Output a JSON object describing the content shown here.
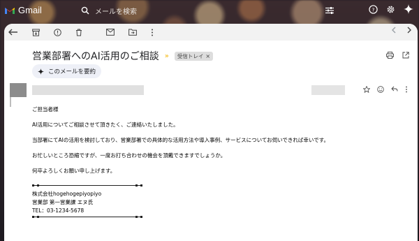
{
  "app": {
    "name": "Gmail"
  },
  "search": {
    "placeholder": "メールを検索"
  },
  "subject": {
    "title": "営業部署へのAI活用のご相談",
    "label": "受信トレイ",
    "label_close": "×"
  },
  "summarize": {
    "label": "このメールを要約"
  },
  "body": {
    "greeting": "ご担当者様",
    "p1": "AI活用についてご相談させて頂きたく、ご連絡いたしました。",
    "p2": "当部署にてAIの活用を検討しており、営業部署での具体的な活用方法や導入事例、サービスについてお伺いできれば幸いです。",
    "p3": "お忙しいところ恐縮ですが、一度お打ち合わせの機会を頂戴できますでしょうか。",
    "p4": "何卒よろしくお願い申し上げます。"
  },
  "signature": {
    "company": "株式会社hogehogepiyopiyo",
    "dept": "営業部 第一営業課 エヌ氏",
    "tel": "TEL：03-1234-5678"
  },
  "colors": {
    "accent": "#1a73e8",
    "important": "#f4b400"
  }
}
